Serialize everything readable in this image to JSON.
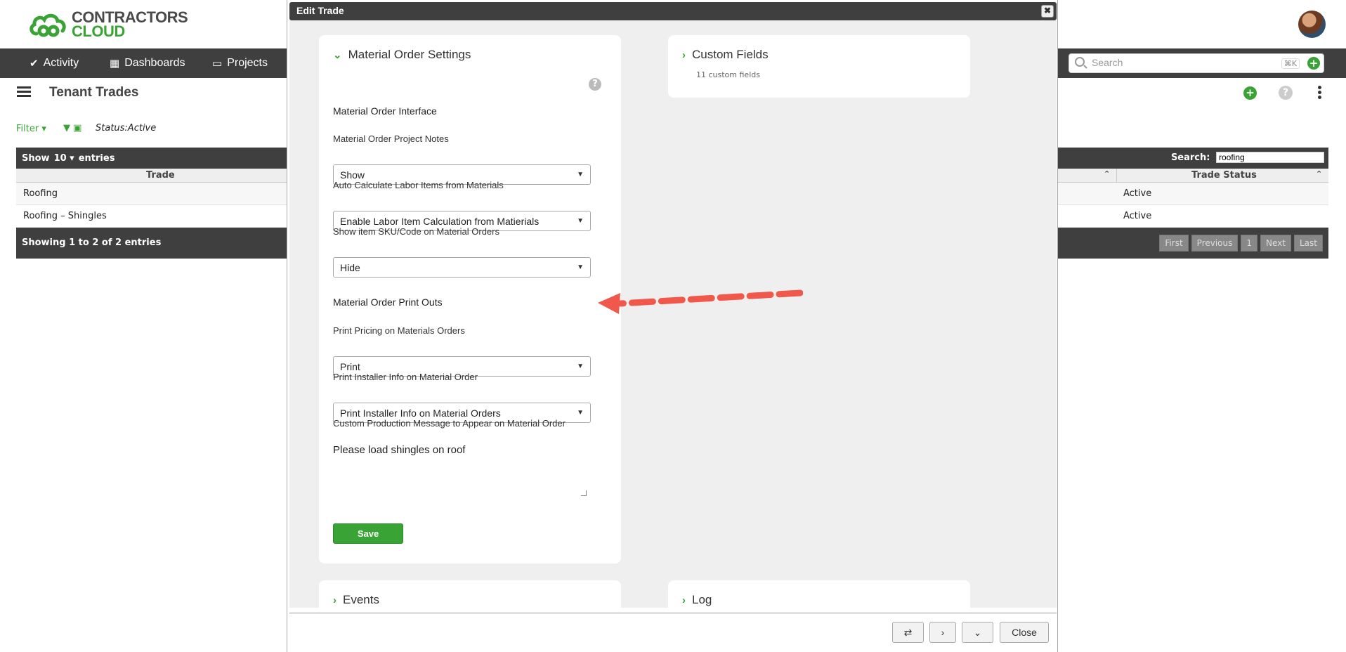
{
  "app": {
    "logo_line1": "CONTRACTORS",
    "logo_line2": "CLOUD",
    "nav": [
      {
        "label": "Activity",
        "icon": "check-circle-icon"
      },
      {
        "label": "Dashboards",
        "icon": "grid-icon"
      },
      {
        "label": "Projects",
        "icon": "folder-open-icon"
      }
    ],
    "search_placeholder": "Search",
    "search_shortcut": "⌘K",
    "page_title": "Tenant Trades",
    "filter_label": "Filter",
    "status_filter": "Status:Active"
  },
  "table": {
    "show_label": "Show",
    "page_size": "10",
    "entries_label": "entries",
    "search_label": "Search:",
    "search_value": "roofing",
    "columns": [
      "Trade",
      "Trade Status"
    ],
    "rows": [
      {
        "trade": "Roofing",
        "status": "Active"
      },
      {
        "trade": "Roofing – Shingles",
        "status": "Active"
      }
    ],
    "info": "Showing 1 to 2 of 2 entries",
    "pager": [
      "First",
      "Previous",
      "1",
      "Next",
      "Last"
    ]
  },
  "modal": {
    "title": "Edit Trade",
    "close_x": "✖",
    "material_panel": {
      "heading": "Material Order Settings",
      "interface_title": "Material Order Interface",
      "fields": [
        {
          "label": "Material Order Project Notes",
          "value": "Show"
        },
        {
          "label": "Auto Calculate Labor Items from Materials",
          "value": "Enable Labor Item Calculation from Matierials"
        },
        {
          "label": "Show item SKU/Code on Material Orders",
          "value": "Hide"
        }
      ],
      "printouts_title": "Material Order Print Outs",
      "print_fields": [
        {
          "label": "Print Pricing on Materials Orders",
          "value": "Print"
        },
        {
          "label": "Print Installer Info on Material Order",
          "value": "Print Installer Info on Material Orders"
        }
      ],
      "message_label": "Custom Production Message to Appear on Material Order",
      "message_value": "Please load shingles on roof",
      "save_label": "Save"
    },
    "custom_fields": {
      "heading": "Custom Fields",
      "note": "11 custom fields"
    },
    "events_heading": "Events",
    "log_heading": "Log",
    "footer": {
      "close_label": "Close"
    }
  },
  "colors": {
    "accent_green": "#3aa335",
    "dark_bar": "#3f3f3f",
    "arrow_red": "#f0584b"
  }
}
